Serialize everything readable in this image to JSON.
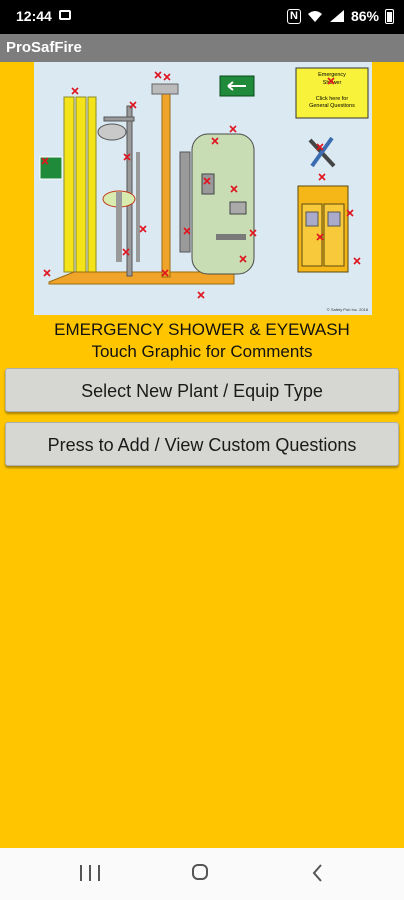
{
  "status_bar": {
    "time": "12:44",
    "battery": "86%"
  },
  "app_bar": {
    "title": "ProSafFire"
  },
  "graphic": {
    "emergency_box": [
      "Emergency",
      "Shower",
      "",
      "Click here for",
      "General Questions"
    ],
    "copyright": "© Safety Pub Inc. 2018"
  },
  "subtitle": {
    "line1": "EMERGENCY SHOWER & EYEWASH",
    "line2": "Touch Graphic for Comments"
  },
  "buttons": {
    "select_plant": "Select New Plant  / Equip Type",
    "custom_questions": "Press to Add / View Custom Questions"
  },
  "colors": {
    "background": "#FFC600",
    "app_bar": "#7d7d7d",
    "button": "#d6d6d2",
    "marker": "#e0141e"
  }
}
